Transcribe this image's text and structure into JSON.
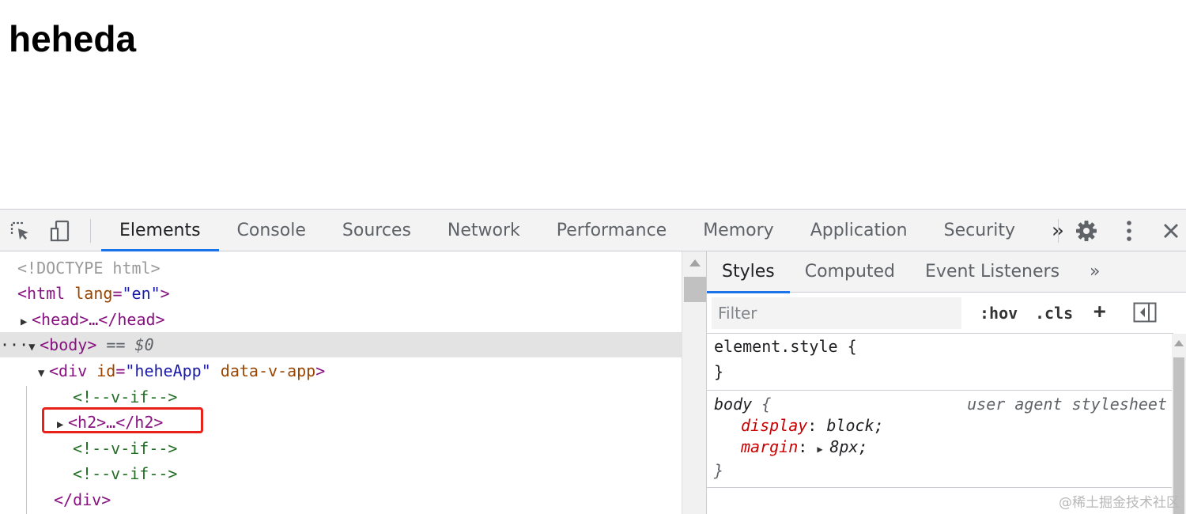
{
  "page": {
    "heading": "heheda"
  },
  "devtools": {
    "main_tabs": [
      "Elements",
      "Console",
      "Sources",
      "Network",
      "Performance",
      "Memory",
      "Application",
      "Security"
    ],
    "more_tabs_glyph": "»",
    "active_tab": "Elements",
    "icons": {
      "inspect": "inspect-element-icon",
      "device": "device-toolbar-icon",
      "settings": "gear-icon",
      "menu": "kebab-menu-icon",
      "close": "close-icon"
    },
    "dom": {
      "doctype": "<!DOCTYPE html>",
      "html_open": "<html",
      "html_attr": "lang",
      "html_val": "\"en\"",
      "head_collapsed": "<head>…</head>",
      "body_tag": "<body>",
      "body_note": "== $0",
      "div_open": "<div",
      "div_attr_id": "id",
      "div_attr_id_val": "\"heheApp\"",
      "div_attr_app": "data-v-app",
      "div_close_bracket": ">",
      "comment": "<!--v-if-->",
      "h2_collapsed": "<h2>…</h2>",
      "div_close": "</div>",
      "ellipsis": "···"
    },
    "styles": {
      "subtabs": [
        "Styles",
        "Computed",
        "Event Listeners"
      ],
      "more_glyph": "»",
      "filter_placeholder": "Filter",
      "hov": ":hov",
      "cls": ".cls",
      "plus": "+",
      "element_style_open": "element.style {",
      "brace_close": "}",
      "body_selector": "body",
      "brace_open": "{",
      "user_agent": "user agent stylesheet",
      "props": [
        {
          "name": "display",
          "value": "block;"
        },
        {
          "name": "margin",
          "value": "8px;"
        }
      ]
    },
    "colors": {
      "accent": "#1a73e8",
      "highlight": "#e8221b"
    }
  },
  "watermark": "@稀土掘金技术社区"
}
